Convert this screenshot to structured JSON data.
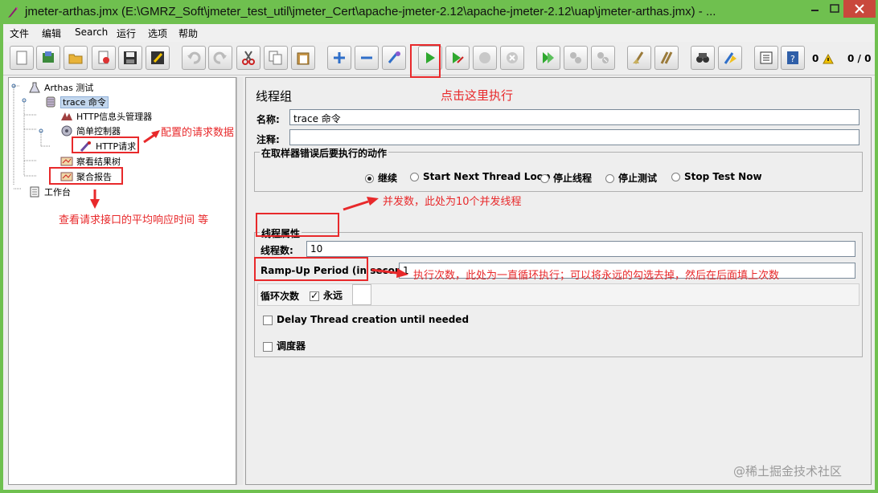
{
  "window": {
    "title": "jmeter-arthas.jmx (E:\\GMRZ_Soft\\jmeter_test_util\\jmeter_Cert\\apache-jmeter-2.12\\apache-jmeter-2.12\\uap\\jmeter-arthas.jmx) - ...",
    "min_icon": "minimize-icon",
    "max_icon": "maximize-icon",
    "close_icon": "close-icon"
  },
  "menu": [
    "文件",
    "编辑",
    "Search",
    "运行",
    "选项",
    "帮助"
  ],
  "toolbar": {
    "buttons": [
      "new-icon",
      "templates-icon",
      "open-icon",
      "close-file-icon",
      "save-icon",
      "save-as-icon",
      "undo-icon",
      "redo-icon",
      "cut-icon",
      "copy-icon",
      "paste-icon",
      "expand-icon",
      "collapse-icon",
      "toggle-icon",
      "start-icon",
      "start-no-pause-icon",
      "stop-icon",
      "shutdown-icon",
      "remote-start-icon",
      "remote-stop-icon",
      "remote-shutdown-icon",
      "clear-icon",
      "clear-all-icon",
      "search-icon",
      "reset-search-icon",
      "function-helper-icon",
      "help-icon"
    ],
    "error_count": "0",
    "thread_count": "0 / 0"
  },
  "tree": {
    "items": [
      {
        "label": "Arthas 测试",
        "icon": "test-plan-icon"
      },
      {
        "label": "trace 命令",
        "icon": "thread-group-icon"
      },
      {
        "label": "HTTP信息头管理器",
        "icon": "config-element-icon"
      },
      {
        "label": "简单控制器",
        "icon": "controller-icon"
      },
      {
        "label": "HTTP请求",
        "icon": "sampler-icon"
      },
      {
        "label": "察看结果树",
        "icon": "listener-icon"
      },
      {
        "label": "聚合报告",
        "icon": "listener-icon"
      },
      {
        "label": "工作台",
        "icon": "workbench-icon"
      }
    ]
  },
  "panel": {
    "title": "线程组",
    "name_label": "名称:",
    "name_value": "trace 命令",
    "comment_label": "注释:",
    "comment_value": "",
    "error_action": {
      "title": "在取样器错误后要执行的动作",
      "options": [
        "继续",
        "Start Next Thread Loop",
        "停止线程",
        "停止测试",
        "Stop Test Now"
      ],
      "selected": "继续"
    },
    "thread_props": {
      "title": "线程属性",
      "threads_label": "线程数:",
      "threads_value": "10",
      "rampup_label": "Ramp-Up Period (in seconds):",
      "rampup_value": "1",
      "loop_label": "循环次数",
      "forever_label": "永远",
      "forever_checked": true,
      "delay_label": "Delay Thread creation until needed",
      "delay_checked": false,
      "scheduler_label": "调度器",
      "scheduler_checked": false
    }
  },
  "annotations": {
    "run": "点击这里执行",
    "request": "配置的请求数据",
    "report": "查看请求接口的平均响应时间 等",
    "threads": "并发数，此处为10个并发线程",
    "loop": "执行次数，此处为一直循环执行；可以将永远的勾选去掉，然后在后面填上次数"
  },
  "watermark": "@稀土掘金技术社区",
  "colors": {
    "accent_red": "#e8292b",
    "frame_green": "#6fc04f",
    "selection": "#c3d7ee"
  }
}
